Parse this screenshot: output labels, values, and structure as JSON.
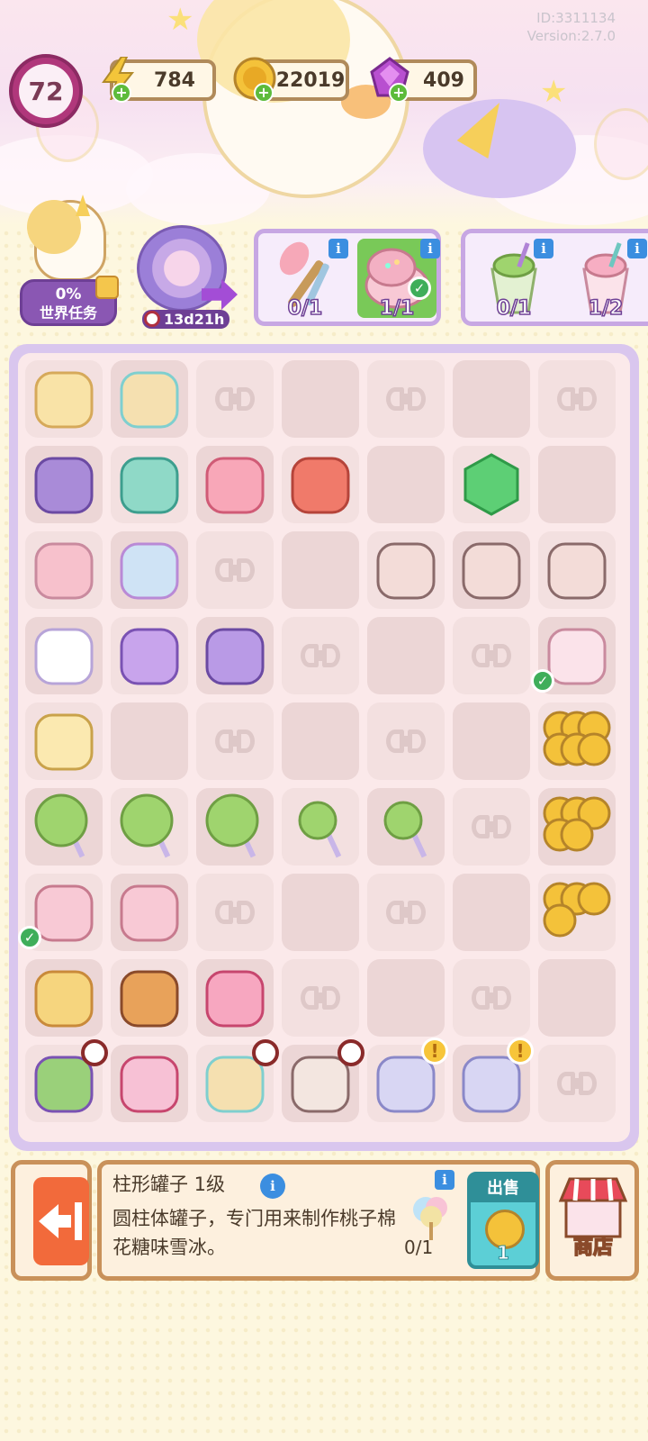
{
  "header": {
    "id_text": "ID:3311134",
    "version_text": "Version:2.7.0",
    "level": "72",
    "energy": "784",
    "coins": "22019",
    "gems": "409"
  },
  "world_task": {
    "percent": "0%",
    "label": "世界任务"
  },
  "event": {
    "timer": "13d21h"
  },
  "orders": [
    {
      "items": [
        {
          "count": "0/1",
          "icon": "makeup-brush-icon",
          "done": false
        },
        {
          "count": "1/1",
          "icon": "powder-compact-icon",
          "done": true
        }
      ]
    },
    {
      "items": [
        {
          "count": "0/1",
          "icon": "matcha-drink-icon",
          "done": false
        },
        {
          "count": "1/2",
          "icon": "strawberry-drink-icon",
          "done": false
        }
      ]
    }
  ],
  "board": {
    "rows": [
      [
        "cheese-wedge",
        "gift-box-ribbon",
        "empty-bow",
        "empty",
        "empty-bow",
        "empty",
        "empty-bow"
      ],
      [
        "purple-bear-plush",
        "teal-elephant-plush",
        "pink-bunny-plush",
        "red-hamster-plush",
        "empty",
        "infinity-hexagon",
        "empty"
      ],
      [
        "pink-marshmallow",
        "candy-plate",
        "empty-bow",
        "empty",
        "pink-nightstand",
        "pink-drawer",
        "pink-cabinet"
      ],
      [
        "white-dress",
        "purple-dress",
        "purple-cardigan",
        "empty-bow",
        "empty",
        "empty-bow",
        "strawberry-drink"
      ],
      [
        "ticket",
        "empty",
        "empty-bow",
        "empty",
        "empty-bow",
        "empty",
        "gold-coins-large"
      ],
      [
        "green-lollipop",
        "green-lollipop",
        "green-lollipop",
        "green-lollipop-stick",
        "green-lollipop-stick",
        "empty-bow",
        "gold-coins-medium"
      ],
      [
        "powder-compact",
        "lint-roller",
        "empty-bow",
        "empty",
        "empty-bow",
        "empty",
        "gold-coins-small"
      ],
      [
        "carousel",
        "swing-ride",
        "pink-castle",
        "empty-bow",
        "empty",
        "empty-bow",
        "empty"
      ],
      [
        "toy-shop",
        "pink-bed",
        "gift-box-bag",
        "pink-wardrobe",
        "glass-jar",
        "glass-jar",
        "empty-bow"
      ]
    ]
  },
  "selected": {
    "title": "柱形罐子 1级",
    "description": "圆柱体罐子，专门用来制作桃子棉花糖味雪冰。",
    "requirement": "0/1",
    "sell_label": "出售",
    "sell_price": "1"
  },
  "shop_label": "商店",
  "colors": {
    "accent": "#c7a7e3",
    "coin": "#f4c23a",
    "gem": "#b84fd0",
    "energy": "#f3c53a"
  }
}
